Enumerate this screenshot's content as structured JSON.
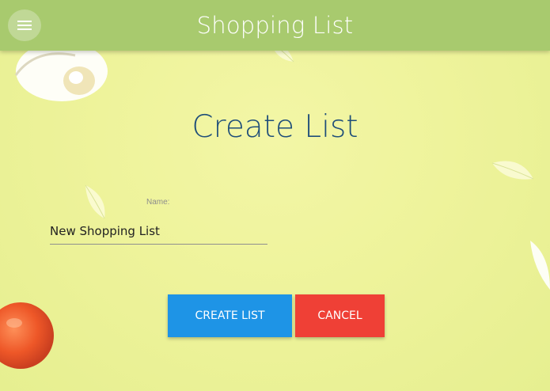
{
  "header": {
    "title": "Shopping List",
    "menu_icon": "menu-icon"
  },
  "main": {
    "title": "Create List",
    "form": {
      "name_label": "Name:",
      "name_value": "New Shopping List"
    },
    "buttons": {
      "create_label": "CREATE LIST",
      "cancel_label": "CANCEL"
    }
  },
  "colors": {
    "header_bg": "#a8ca6e",
    "page_bg": "#eef39b",
    "title_text": "#1f4e79",
    "create_button": "#1e94e6",
    "cancel_button": "#ef4036"
  }
}
